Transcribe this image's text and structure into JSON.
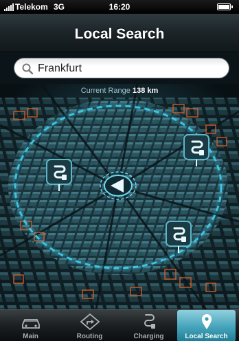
{
  "status_bar": {
    "carrier": "Telekom",
    "network": "3G",
    "time": "16:20"
  },
  "header": {
    "title": "Local Search"
  },
  "search": {
    "value": "Frankfurt"
  },
  "map": {
    "range_label": "Current Range",
    "range_value": "138 km"
  },
  "tabs": [
    {
      "label": "Main",
      "icon": "car-icon",
      "active": false
    },
    {
      "label": "Routing",
      "icon": "routing-icon",
      "active": false
    },
    {
      "label": "Charging",
      "icon": "charging-plug-icon",
      "active": false
    },
    {
      "label": "Local Search",
      "icon": "location-pin-icon",
      "active": true
    }
  ],
  "colors": {
    "accent": "#3fb7d3",
    "range_ring": "#3fd0f0",
    "city_highlight": "#e0602a",
    "active_tab": "#4aa7bd"
  }
}
